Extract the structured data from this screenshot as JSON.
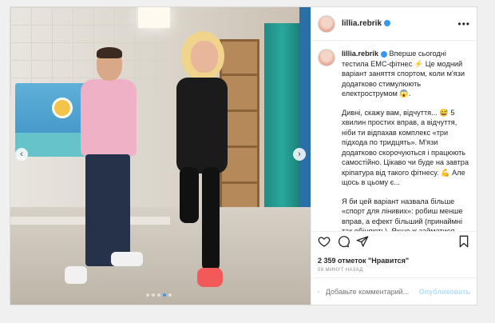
{
  "post": {
    "username": "lillia.rebrik",
    "more_icon": "•••",
    "caption_username": "lillia.rebrik",
    "caption_p1": "Вперше сьогодні тестила ЕМС-фітнес ⚡ Це модний варіант заняття спортом, коли м'язи додатково стимулюють електрострумом 😱.",
    "caption_p2": "Дивні, скажу вам, відчуття... 😅 5 хвилин простих вправ, а відчуття, ніби ти відпахав комплекс «три підхода по тридцять». М'язи додатково скорочуються і працюють самостійно. Цікаво чи буде на завтра кріпатура від такого фітнесу. 💪 Але щось в цьому є...",
    "caption_p3": "Я би цей варіант назвала більше «спорт для лінивих»: робиш менше вправ, а ефект більший (принаймні так обіцяють). Якщо ж займатися",
    "likes": "2 359 отметок \"Нравится\"",
    "time": "59 минут назад",
    "comment_placeholder": "Добавьте комментарий...",
    "post_label": "Опубликовать"
  },
  "carousel": {
    "prev": "‹",
    "next": "›",
    "slides": 5,
    "active_slide": 3
  },
  "colors": {
    "accent": "#3897f0",
    "text": "#262626",
    "muted": "#8e8e8e"
  }
}
